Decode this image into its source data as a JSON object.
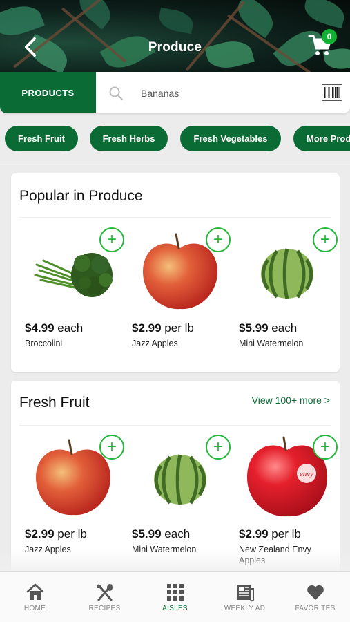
{
  "header": {
    "title": "Produce",
    "cart_count": "0"
  },
  "search": {
    "products_tab": "PRODUCTS",
    "placeholder": "Bananas"
  },
  "chips": [
    "Fresh Fruit",
    "Fresh Herbs",
    "Fresh Vegetables",
    "More Prod"
  ],
  "popular": {
    "title": "Popular in Produce",
    "products": [
      {
        "price": "$4.99",
        "unit": "each",
        "name": "Broccolini",
        "icon": "broccolini-image"
      },
      {
        "price": "$2.99",
        "unit": "per lb",
        "name": "Jazz Apples",
        "icon": "apple-image"
      },
      {
        "price": "$5.99",
        "unit": "each",
        "name": "Mini Watermelon",
        "icon": "watermelon-image"
      }
    ]
  },
  "fresh_fruit": {
    "title": "Fresh Fruit",
    "view_more": "View 100+ more >",
    "products": [
      {
        "price": "$2.99",
        "unit": "per lb",
        "name": "Jazz Apples",
        "icon": "apple-image"
      },
      {
        "price": "$5.99",
        "unit": "each",
        "name": "Mini Watermelon",
        "icon": "watermelon-image"
      },
      {
        "price": "$2.99",
        "unit": "per lb",
        "name": "New Zealand Envy Apples",
        "icon": "envy-apple-image"
      }
    ]
  },
  "tabs": [
    {
      "label": "HOME",
      "icon": "home-icon"
    },
    {
      "label": "RECIPES",
      "icon": "utensils-icon"
    },
    {
      "label": "AISLES",
      "icon": "grid-icon",
      "active": true
    },
    {
      "label": "WEEKLY AD",
      "icon": "newspaper-icon"
    },
    {
      "label": "FAVORITES",
      "icon": "heart-icon"
    }
  ],
  "colors": {
    "brand_green": "#0b6b35",
    "add_green": "#22b83a",
    "badge_green": "#12b133"
  }
}
